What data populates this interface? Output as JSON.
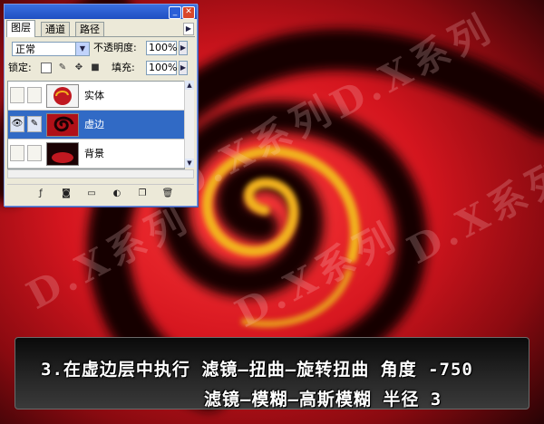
{
  "layers_panel": {
    "tabs": [
      "图层",
      "通道",
      "路径"
    ],
    "blend_mode": "正常",
    "opacity_label": "不透明度:",
    "opacity_value": "100%",
    "lock_label": "锁定:",
    "fill_label": "填充:",
    "fill_value": "100%",
    "layers": [
      {
        "name": "实体",
        "visible": false,
        "selected": false
      },
      {
        "name": "虚边",
        "visible": true,
        "selected": true
      },
      {
        "name": "背景",
        "visible": false,
        "selected": false
      }
    ],
    "bottom_icons": [
      "link-layers-icon",
      "layer-style-icon",
      "layer-mask-icon",
      "new-group-icon",
      "adjustment-layer-icon",
      "new-layer-icon",
      "delete-layer-icon"
    ]
  },
  "caption": {
    "line1": "3.在虚边层中执行  滤镜—扭曲—旋转扭曲  角度 -750",
    "line2": "滤镜—模糊—高斯模糊  半径  3"
  },
  "watermark": "D.X系列",
  "colors": {
    "swirl_red": "#d8202a",
    "swirl_yellow": "#f2b21e",
    "swirl_dark": "#100204",
    "selection_blue": "#316ac5",
    "panel_bg": "#ece9d8"
  }
}
